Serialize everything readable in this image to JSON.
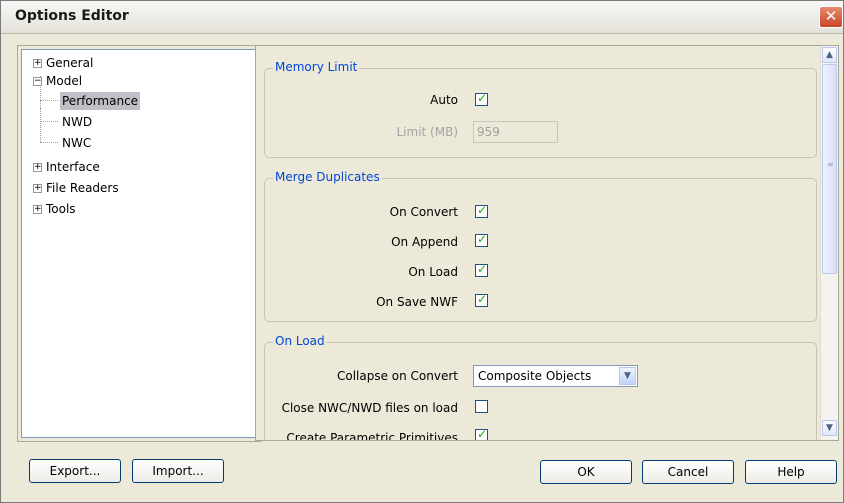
{
  "window": {
    "title": "Options Editor",
    "close_glyph": "✕"
  },
  "tree": [
    {
      "label": "General",
      "expander": "+"
    },
    {
      "label": "Model",
      "expander": "−"
    },
    {
      "label": "Performance",
      "selected": true
    },
    {
      "label": "NWD"
    },
    {
      "label": "NWC"
    },
    {
      "label": "Interface",
      "expander": "+"
    },
    {
      "label": "File Readers",
      "expander": "+"
    },
    {
      "label": "Tools",
      "expander": "+"
    }
  ],
  "memory_limit": {
    "title": "Memory Limit",
    "auto_label": "Auto",
    "auto_checked": true,
    "limit_label": "Limit (MB)",
    "limit_value": "959"
  },
  "merge_duplicates": {
    "title": "Merge Duplicates",
    "items": [
      {
        "label": "On Convert",
        "checked": true
      },
      {
        "label": "On Append",
        "checked": true
      },
      {
        "label": "On Load",
        "checked": true
      },
      {
        "label": "On Save NWF",
        "checked": true
      }
    ]
  },
  "on_load": {
    "title": "On Load",
    "collapse_label": "Collapse on Convert",
    "collapse_value": "Composite Objects",
    "close_files_label": "Close NWC/NWD files on load",
    "close_files_checked": false,
    "parametric_label": "Create Parametric Primitives",
    "parametric_checked": true
  },
  "buttons": {
    "export": "Export...",
    "import": "Import...",
    "ok": "OK",
    "cancel": "Cancel",
    "help": "Help"
  },
  "glyphs": {
    "check": "✓",
    "arrow_down": "▼",
    "arrow_up": "▲",
    "grip": "≡"
  }
}
